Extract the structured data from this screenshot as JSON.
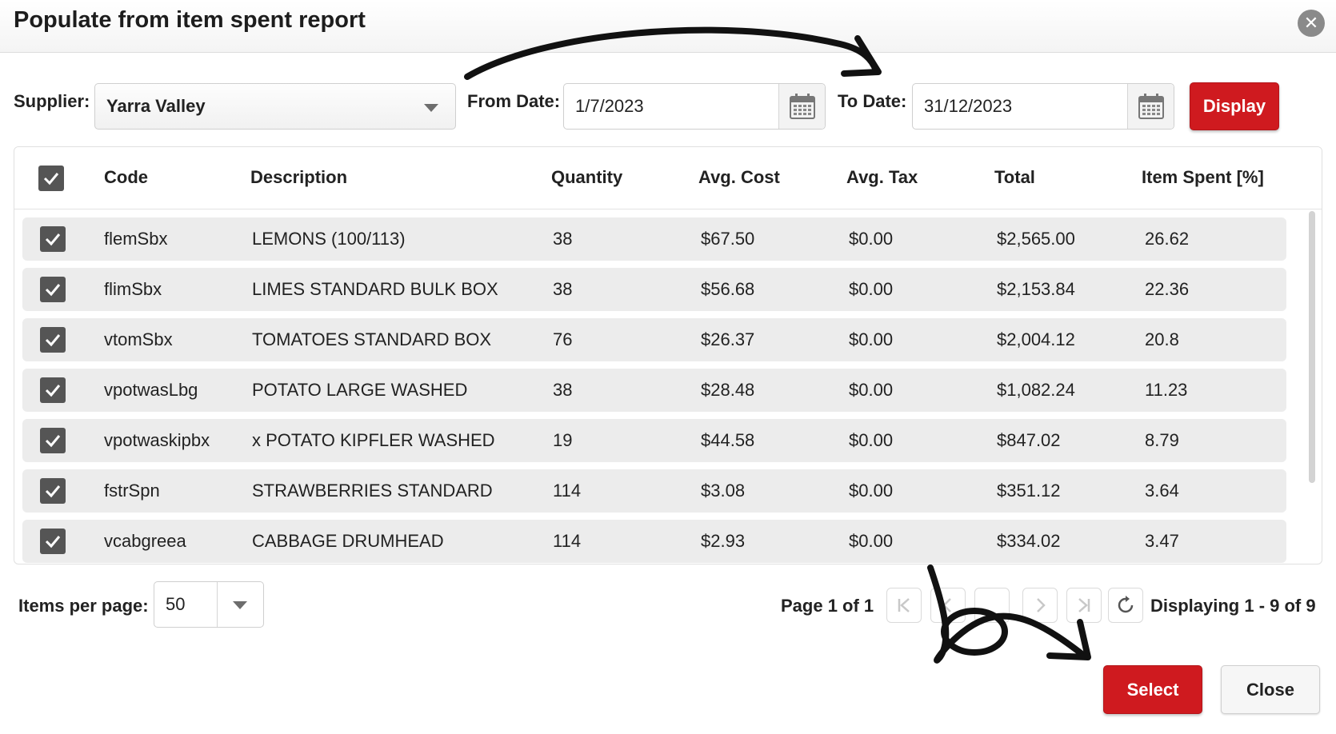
{
  "dialog": {
    "title": "Populate from item spent report"
  },
  "filters": {
    "supplier_label": "Supplier:",
    "supplier_value": "Yarra Valley",
    "from_label": "From Date:",
    "from_value": "1/7/2023",
    "to_label": "To Date:",
    "to_value": "31/12/2023",
    "display_label": "Display"
  },
  "grid": {
    "columns": [
      "Code",
      "Description",
      "Quantity",
      "Avg. Cost",
      "Avg. Tax",
      "Total",
      "Item Spent [%]"
    ],
    "rows": [
      {
        "code": "flemSbx",
        "description": "LEMONS (100/113)",
        "quantity": "38",
        "avg_cost": "$67.50",
        "avg_tax": "$0.00",
        "total": "$2,565.00",
        "spent": "26.62"
      },
      {
        "code": "flimSbx",
        "description": "LIMES STANDARD BULK BOX",
        "quantity": "38",
        "avg_cost": "$56.68",
        "avg_tax": "$0.00",
        "total": "$2,153.84",
        "spent": "22.36"
      },
      {
        "code": "vtomSbx",
        "description": "TOMATOES STANDARD BOX",
        "quantity": "76",
        "avg_cost": "$26.37",
        "avg_tax": "$0.00",
        "total": "$2,004.12",
        "spent": "20.8"
      },
      {
        "code": "vpotwasLbg",
        "description": "POTATO LARGE WASHED",
        "quantity": "38",
        "avg_cost": "$28.48",
        "avg_tax": "$0.00",
        "total": "$1,082.24",
        "spent": "11.23"
      },
      {
        "code": "vpotwaskipbx",
        "description": "x POTATO KIPFLER WASHED",
        "quantity": "19",
        "avg_cost": "$44.58",
        "avg_tax": "$0.00",
        "total": "$847.02",
        "spent": "8.79"
      },
      {
        "code": "fstrSpn",
        "description": "STRAWBERRIES STANDARD",
        "quantity": "114",
        "avg_cost": "$3.08",
        "avg_tax": "$0.00",
        "total": "$351.12",
        "spent": "3.64"
      },
      {
        "code": "vcabgreea",
        "description": "CABBAGE DRUMHEAD",
        "quantity": "114",
        "avg_cost": "$2.93",
        "avg_tax": "$0.00",
        "total": "$334.02",
        "spent": "3.47"
      }
    ]
  },
  "pager": {
    "items_label": "Items per page:",
    "items_value": "50",
    "page_label": "Page 1 of 1",
    "display_info": "Displaying 1 - 9 of 9"
  },
  "footer": {
    "select_label": "Select",
    "close_label": "Close"
  },
  "colors": {
    "accent": "#cf1a1f",
    "row_bg": "#ececec",
    "checkbox": "#555555"
  }
}
